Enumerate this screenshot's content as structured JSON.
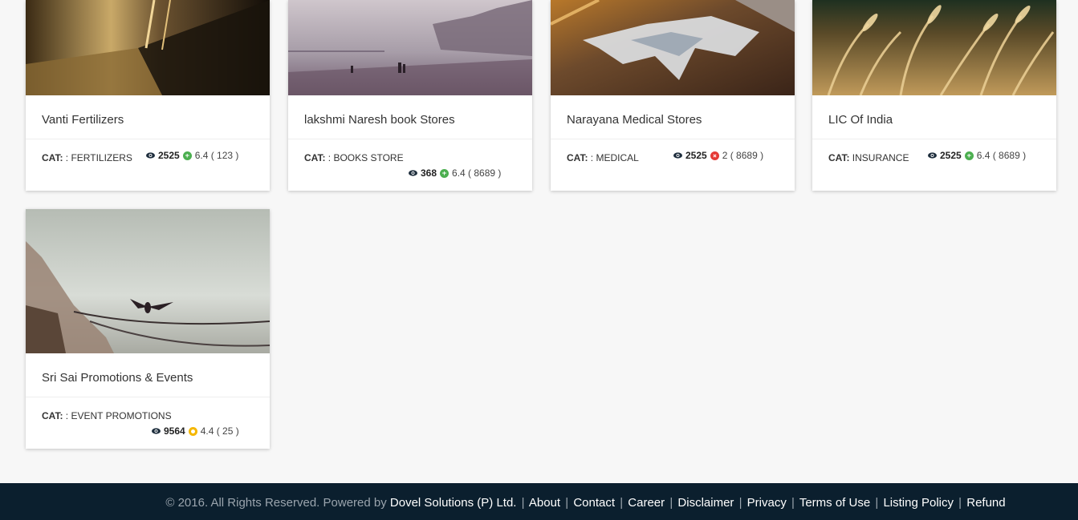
{
  "listings": [
    {
      "title": "Vanti Fertilizers",
      "cat_label": "CAT:",
      "cat_value": ": FERTILIZERS",
      "views": "2525",
      "rating": "6.4 ( 123 )",
      "rating_color": "#4caf50",
      "image": "hallway-icon"
    },
    {
      "title": "lakshmi Naresh book Stores",
      "cat_label": "CAT:",
      "cat_value": ": BOOKS STORE",
      "views": "368",
      "rating": "6.4 ( 8689 )",
      "rating_color": "#4caf50",
      "image": "beach-icon"
    },
    {
      "title": "Narayana Medical Stores",
      "cat_label": "CAT:",
      "cat_value": ": MEDICAL",
      "views": "2525",
      "rating": "2 ( 8689 )",
      "rating_color": "#e53935",
      "image": "road-puddle-icon"
    },
    {
      "title": "LIC Of India",
      "cat_label": "CAT:",
      "cat_value": "INSURANCE",
      "views": "2525",
      "rating": "6.4 ( 8689 )",
      "rating_color": "#4caf50",
      "image": "wheat-icon"
    },
    {
      "title": "Sri Sai Promotions & Events",
      "cat_label": "CAT:",
      "cat_value": ": EVENT PROMOTIONS",
      "views": "9564",
      "rating": "4.4 ( 25 )",
      "rating_color": "#f5b700",
      "image": "bird-lake-icon"
    }
  ],
  "footer": {
    "copyright": "© 2016. All Rights Reserved. Powered by ",
    "company": "Dovel Solutions (P) Ltd.",
    "links": [
      "About",
      "Contact",
      "Career",
      "Disclaimer",
      "Privacy",
      "Terms of Use",
      "Listing Policy",
      "Refund"
    ],
    "separator": "|"
  }
}
